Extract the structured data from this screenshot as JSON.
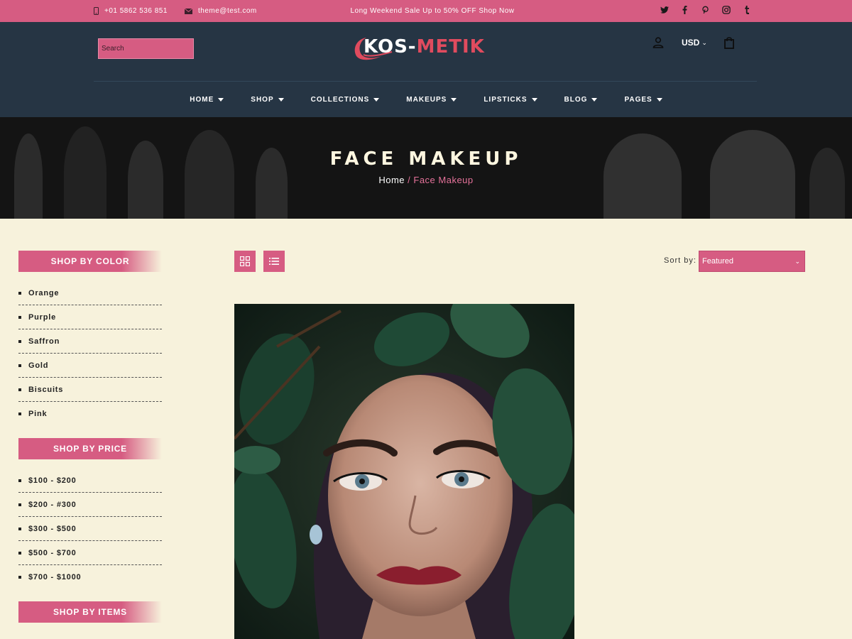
{
  "topbar": {
    "phone": "+01 5862 536 851",
    "email": "theme@test.com",
    "promo": "Long Weekend Sale Up to 50% OFF Shop Now",
    "social": [
      "twitter-icon",
      "facebook-icon",
      "pinterest-icon",
      "instagram-icon",
      "tumblr-icon"
    ]
  },
  "header": {
    "search_placeholder": "Search",
    "logo_part1": "KOS-",
    "logo_part2": "METIK",
    "currency": "USD"
  },
  "nav": {
    "items": [
      {
        "label": "HOME"
      },
      {
        "label": "SHOP"
      },
      {
        "label": "COLLECTIONS"
      },
      {
        "label": "MAKEUPS"
      },
      {
        "label": "LIPSTICKS"
      },
      {
        "label": "BLOG"
      },
      {
        "label": "PAGES"
      }
    ]
  },
  "banner": {
    "title": "FACE MAKEUP",
    "crumb_home": "Home",
    "crumb_current": "/ Face Makeup"
  },
  "sidebar": {
    "color_title": "SHOP BY COLOR",
    "colors": [
      "Orange",
      "Purple",
      "Saffron",
      "Gold",
      "Biscuits",
      "Pink"
    ],
    "price_title": "SHOP BY PRICE",
    "prices": [
      "$100 - $200",
      "$200 - #300",
      "$300 - $500",
      "$500 - $700",
      "$700 - $1000"
    ],
    "items_title": "SHOP BY ITEMS"
  },
  "toolbar": {
    "sort_label": "Sort by:",
    "sort_value": "Featured"
  },
  "colors": {
    "accent": "#d65c82",
    "header_bg": "#263544",
    "page_bg": "#f7f2dc"
  }
}
